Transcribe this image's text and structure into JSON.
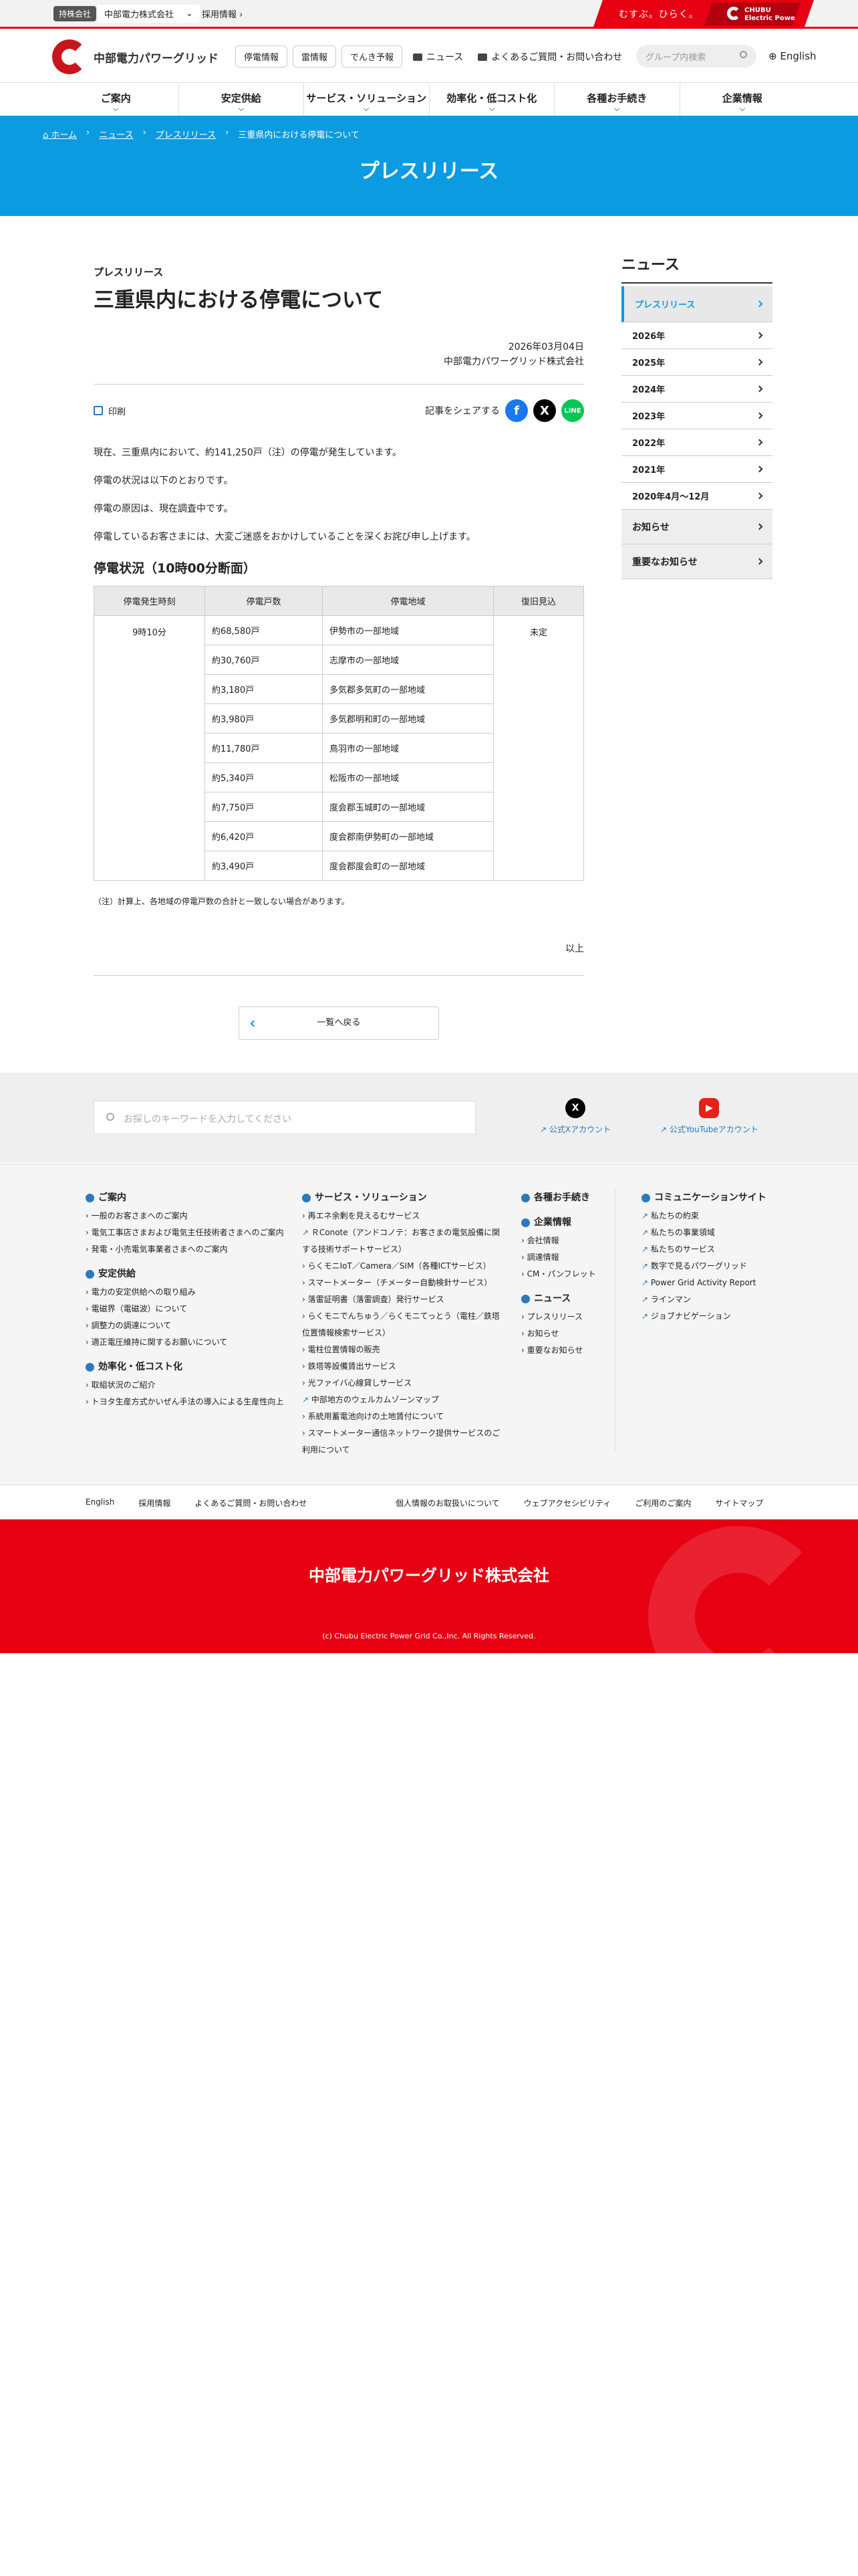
{
  "utility": {
    "holding_tag": "持株会社",
    "holding_select": "中部電力株式会社",
    "recruit": "採用情報",
    "brand_copy": "むすぶ。ひらく。",
    "brand_logo_line1": "CHUBU",
    "brand_logo_line2": "Electric Power"
  },
  "header": {
    "logo_text": "中部電力パワーグリッド",
    "buttons": [
      "停電情報",
      "雷情報",
      "でんき予報"
    ],
    "links": [
      "ニュース",
      "よくあるご質問・お問い合わせ"
    ],
    "search_placeholder": "グループ内検索",
    "lang": "English"
  },
  "gnav": [
    "ご案内",
    "安定供給",
    "サービス・ソリューション",
    "効率化・低コスト化",
    "各種お手続き",
    "企業情報"
  ],
  "hero": {
    "breadcrumb": [
      "ホーム",
      "ニュース",
      "プレスリリース",
      "三重県内における停電について"
    ],
    "title": "プレスリリース"
  },
  "article": {
    "kicker": "プレスリリース",
    "title": "三重県内における停電について",
    "date": "2026年03月04日",
    "company": "中部電力パワーグリッド株式会社",
    "print": "印刷",
    "share_label": "記事をシェアする",
    "paragraphs": [
      "現在、三重県内において、約141,250戸（注）の停電が発生しています。",
      "停電の状況は以下のとおりです。",
      "停電の原因は、現在調査中です。",
      "停電しているお客さまには、大変ご迷惑をおかけしていることを深くお詫び申し上げます。"
    ],
    "status_heading": "停電状況（10時00分断面）",
    "table": {
      "headers": [
        "停電発生時刻",
        "停電戸数",
        "停電地域",
        "復旧見込"
      ],
      "time": "9時10分",
      "restore": "未定",
      "rows": [
        {
          "count": "約68,580戸",
          "area": "伊勢市の一部地域"
        },
        {
          "count": "約30,760戸",
          "area": "志摩市の一部地域"
        },
        {
          "count": "約3,180戸",
          "area": "多気郡多気町の一部地域"
        },
        {
          "count": "約3,980戸",
          "area": "多気郡明和町の一部地域"
        },
        {
          "count": "約11,780戸",
          "area": "鳥羽市の一部地域"
        },
        {
          "count": "約5,340戸",
          "area": "松阪市の一部地域"
        },
        {
          "count": "約7,750戸",
          "area": "度会郡玉城町の一部地域"
        },
        {
          "count": "約6,420戸",
          "area": "度会郡南伊勢町の一部地域"
        },
        {
          "count": "約3,490戸",
          "area": "度会郡度会町の一部地域"
        }
      ]
    },
    "note": "（注）計算上、各地域の停電戸数の合計と一致しない場合があります。",
    "end": "以上",
    "back": "一覧へ戻る"
  },
  "sidebar": {
    "title": "ニュース",
    "active": "プレスリリース",
    "years": [
      "2026年",
      "2025年",
      "2024年",
      "2023年",
      "2022年",
      "2021年",
      "2020年4月～12月"
    ],
    "sections": [
      "お知らせ",
      "重要なお知らせ"
    ]
  },
  "footer_search": {
    "placeholder": "お探しのキーワードを入力してください",
    "x_label": "公式Xアカウント",
    "yt_label": "公式YouTubeアカウント"
  },
  "sitemap": {
    "col1": [
      {
        "h": "ご案内",
        "items": [
          "一般のお客さまへのご案内",
          "電気工事店さまおよび電気主任技術者さまへのご案内",
          "発電・小売電気事業者さまへのご案内"
        ]
      },
      {
        "h": "安定供給",
        "items": [
          "電力の安定供給への取り組み",
          "電磁界（電磁波）について",
          "調整力の調達について",
          "適正電圧維持に関するお願いについて"
        ]
      },
      {
        "h": "効率化・低コスト化",
        "items": [
          "取組状況のご紹介",
          "トヨタ生産方式かいぜん手法の導入による生産性向上"
        ]
      }
    ],
    "col2": {
      "h": "サービス・ソリューション",
      "items": [
        {
          "t": "再エネ余剰を見えるむサービス",
          "ext": false
        },
        {
          "t": "ＲConote（アンドコノテ：お客さまの電気設備に関する技術サポートサービス）",
          "ext": true
        },
        {
          "t": "らくモニIoT／Camera／SIM（各種ICTサービス）",
          "ext": false
        },
        {
          "t": "スマートメーター（チメーター自動検針サービス）",
          "ext": false
        },
        {
          "t": "落雷証明書（落雷調査）発行サービス",
          "ext": false
        },
        {
          "t": "らくモニでんちゅう／らくモニてっとう（電柱／鉄塔位置情報検索サービス）",
          "ext": false
        },
        {
          "t": "電柱位置情報の販売",
          "ext": false
        },
        {
          "t": "鉄塔等設備賃出サービス",
          "ext": false
        },
        {
          "t": "光ファイバ心線貸しサービス",
          "ext": false
        },
        {
          "t": "中部地方のウェルカムゾーンマップ",
          "ext": true
        },
        {
          "t": "系統用蓄電池向けの土地賃付について",
          "ext": false
        },
        {
          "t": "スマートメーター通信ネットワーク提供サービスのご利用について",
          "ext": false
        }
      ]
    },
    "col3": [
      {
        "h": "各種お手続き",
        "items": []
      },
      {
        "h": "企業情報",
        "items": [
          "会社情報",
          "調達情報",
          "CM・パンフレット"
        ]
      },
      {
        "h": "ニュース",
        "items": [
          "プレスリリース",
          "お知らせ",
          "重要なお知らせ"
        ]
      }
    ],
    "col4": {
      "h": "コミュニケーションサイト",
      "items": [
        "私たちの約束",
        "私たちの事業領域",
        "私たちのサービス",
        "数字で見るパワーグリッド",
        "Power Grid Activity Report",
        "ラインマン",
        "ジョブナビゲーション"
      ]
    }
  },
  "bottom_links": {
    "left": [
      "English",
      "採用情報",
      "よくあるご質問・お問い合わせ"
    ],
    "right": [
      "個人情報のお取扱いについて",
      "ウェブアクセシビリティ",
      "ご利用のご案内",
      "サイトマップ"
    ]
  },
  "red_footer": {
    "name": "中部電力パワーグリッド株式会社",
    "copyright": "(c) Chubu Electric Power Grid Co.,Inc. All Rights Reserved."
  },
  "colors": {
    "brand_red": "#e60012",
    "accent_blue": "#0b9be0",
    "link_blue": "#2a7abf"
  }
}
